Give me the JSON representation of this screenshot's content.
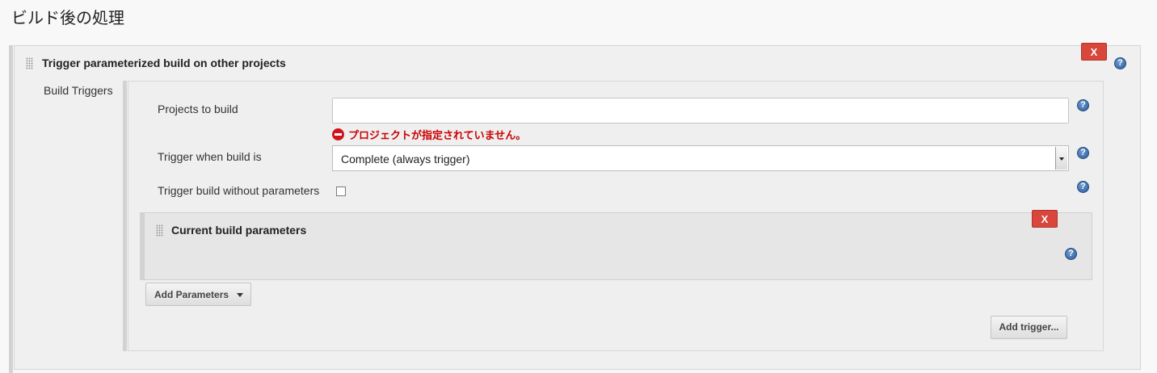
{
  "section": {
    "title": "ビルド後の処理"
  },
  "trigger_panel": {
    "title": "Trigger parameterized build on other projects",
    "delete_label": "X",
    "help_label": "?",
    "build_triggers_label": "Build Triggers"
  },
  "fields": {
    "projects_to_build": {
      "label": "Projects to build",
      "value": "",
      "error": "プロジェクトが指定されていません。"
    },
    "trigger_when": {
      "label": "Trigger when build is",
      "selected": "Complete (always trigger)"
    },
    "without_params": {
      "label": "Trigger build without parameters",
      "checked": false
    }
  },
  "current_params_panel": {
    "title": "Current build parameters",
    "delete_label": "X"
  },
  "buttons": {
    "add_parameters": "Add Parameters",
    "add_trigger": "Add trigger..."
  },
  "colors": {
    "delete_red": "#d9463c",
    "error_red": "#cc0000",
    "help_blue": "#2c5d9a"
  }
}
